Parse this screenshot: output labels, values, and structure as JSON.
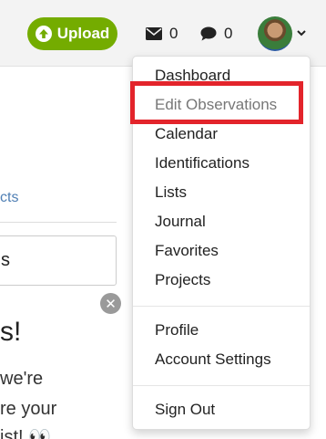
{
  "header": {
    "upload_label": "Upload",
    "mail_count": "0",
    "chat_count": "0",
    "brand_color": "#74ac00"
  },
  "background": {
    "partial_link": "cts",
    "partial_input_text": "s",
    "partial_heading": "s!",
    "partial_lines": [
      "we're",
      "re your",
      "ist! 👀"
    ]
  },
  "menu": {
    "items": [
      {
        "label": "Dashboard"
      },
      {
        "label": "Edit Observations"
      },
      {
        "label": "Calendar"
      },
      {
        "label": "Identifications"
      },
      {
        "label": "Lists"
      },
      {
        "label": "Journal"
      },
      {
        "label": "Favorites"
      },
      {
        "label": "Projects"
      }
    ],
    "account_items": [
      {
        "label": "Profile"
      },
      {
        "label": "Account Settings"
      }
    ],
    "signout_label": "Sign Out",
    "highlight_color": "#e3242b"
  }
}
